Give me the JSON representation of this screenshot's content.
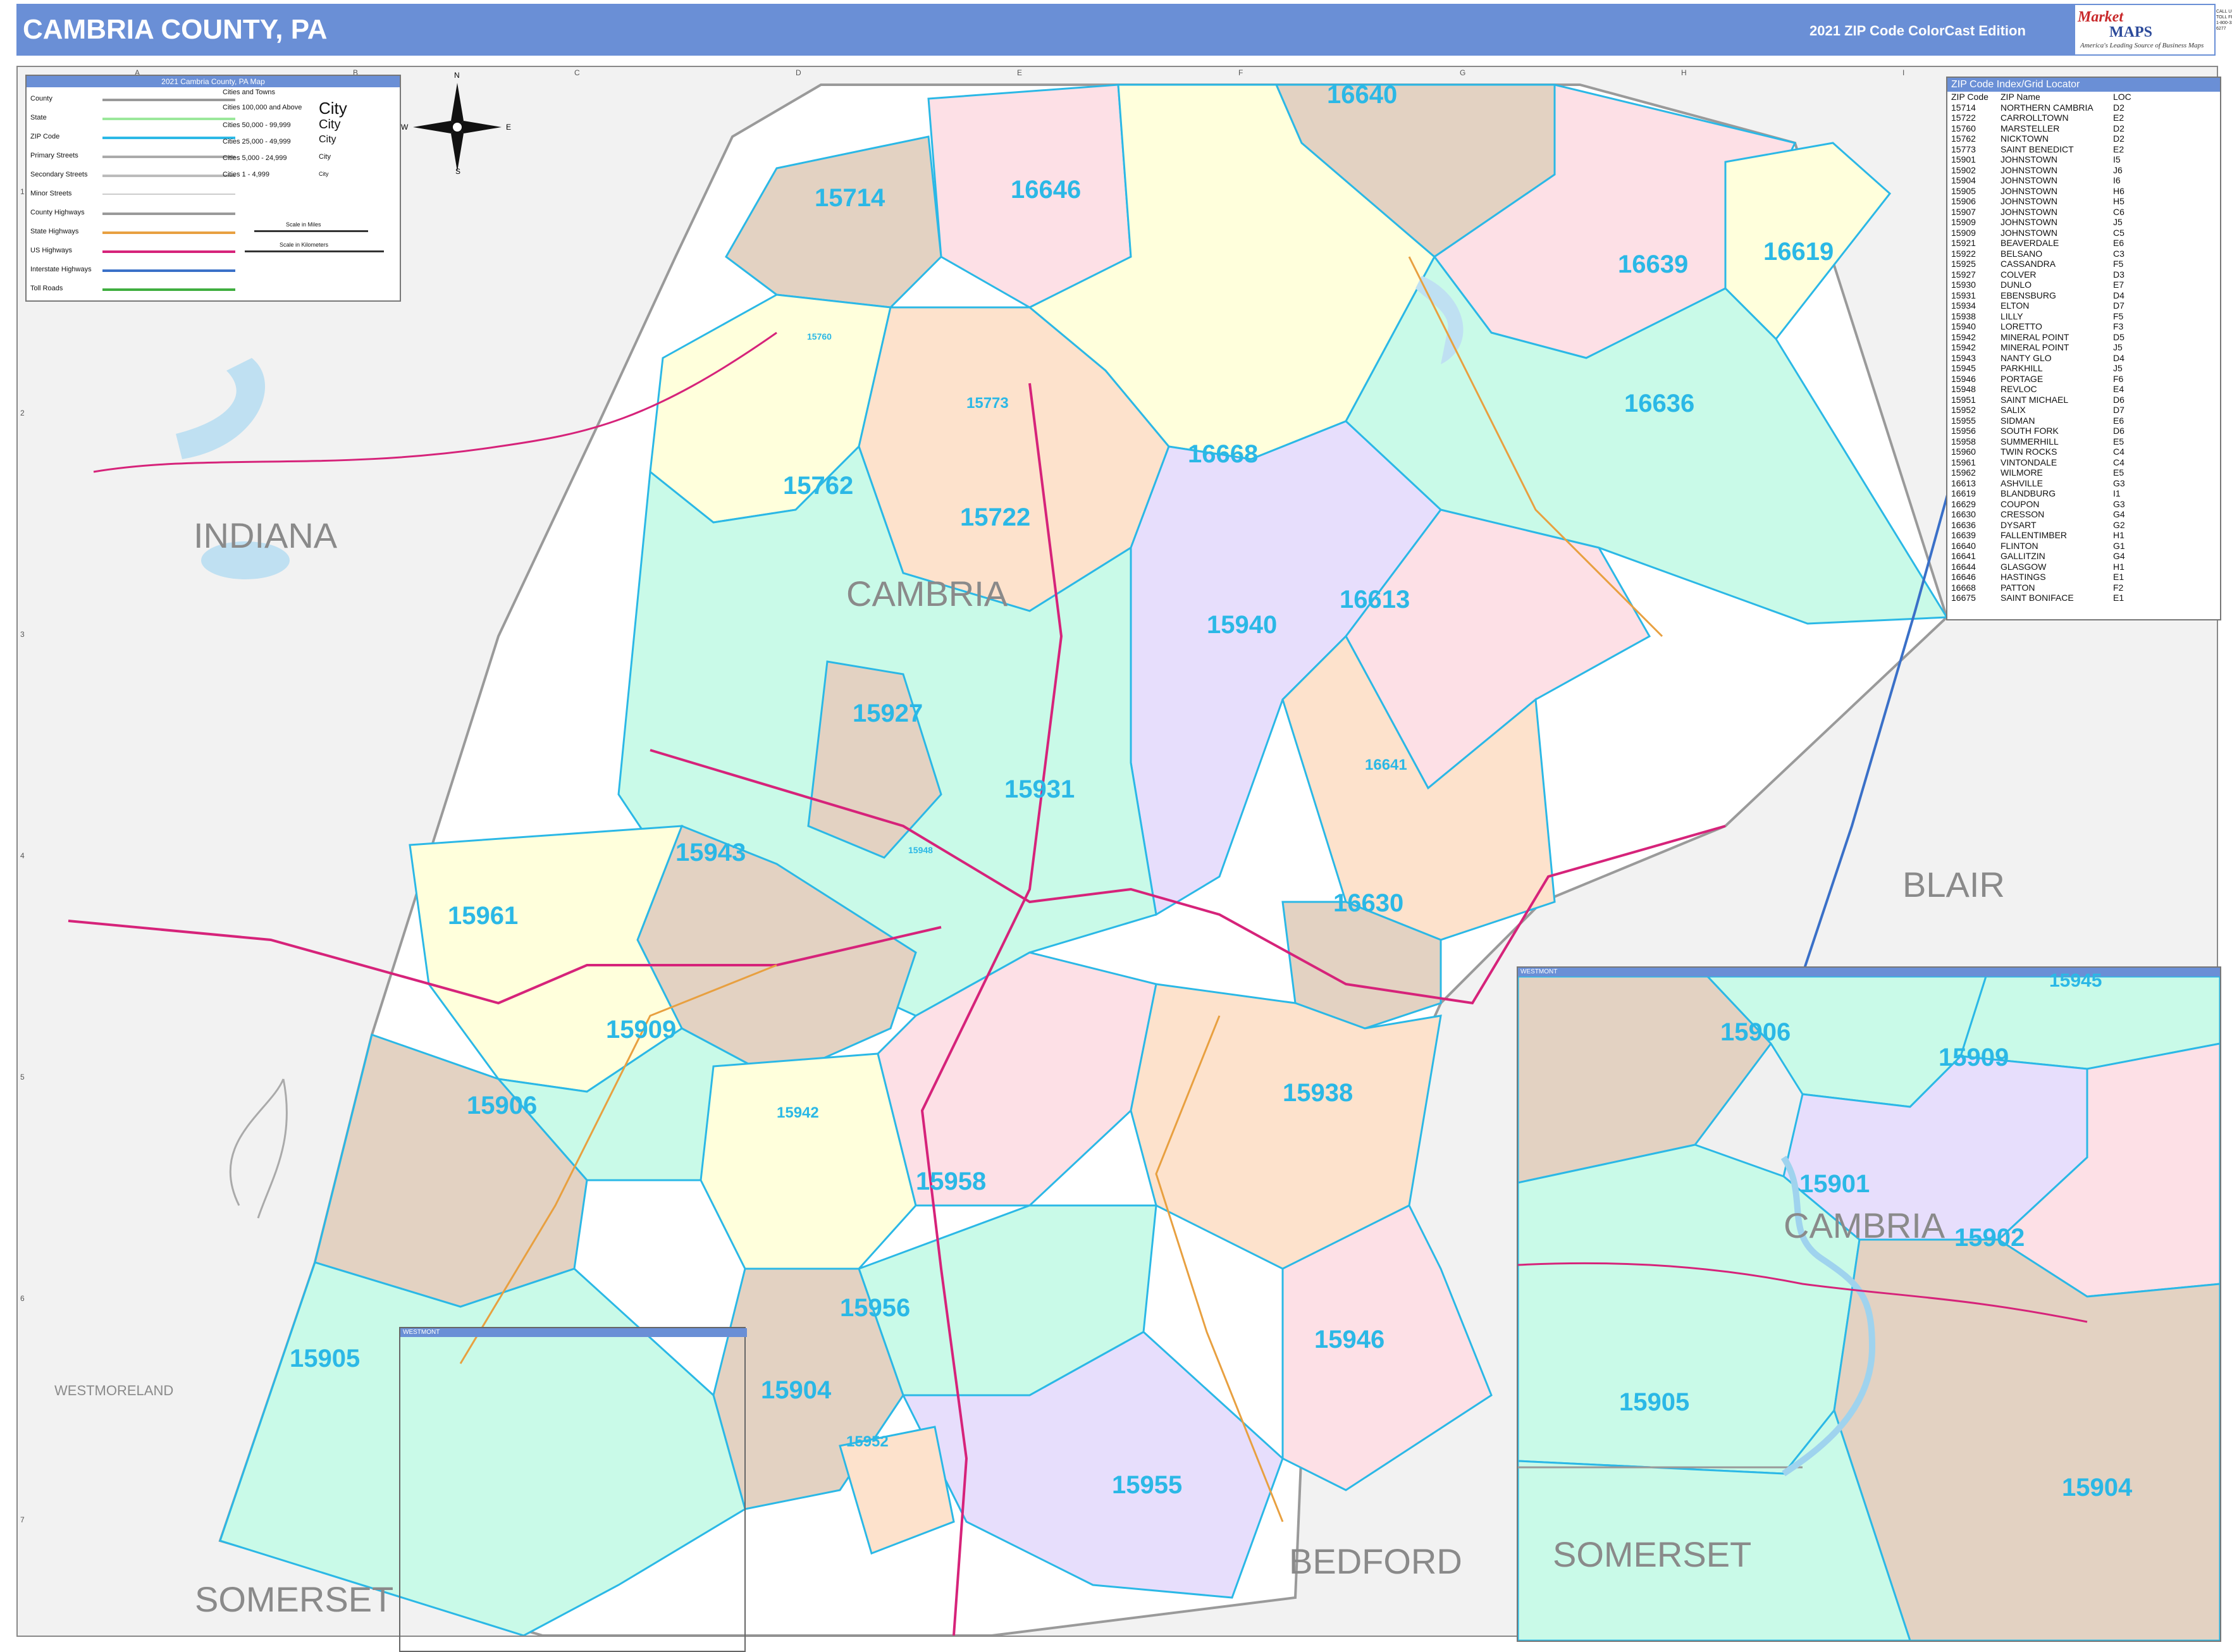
{
  "header": {
    "title": "CAMBRIA COUNTY, PA",
    "edition": "2021 ZIP Code ColorCast Edition",
    "logo_part1": "Market",
    "logo_part2": "MAPS",
    "logo_tagline": "America's Leading Source of Business Maps",
    "logo_contact": "CALL US TOLL FREE 1-800-334-6277"
  },
  "grid": {
    "letters": [
      "A",
      "B",
      "C",
      "D",
      "E",
      "F",
      "G",
      "H",
      "I"
    ],
    "numbers": [
      "1",
      "2",
      "3",
      "4",
      "5",
      "6",
      "7"
    ]
  },
  "legend": {
    "title": "2021 Cambria County, PA Map",
    "items": [
      {
        "label": "County",
        "color": "#999999"
      },
      {
        "label": "State",
        "color": "#9be89b"
      },
      {
        "label": "ZIP Code",
        "color": "#2bb8e6"
      },
      {
        "label": "Primary Streets",
        "color": "#aaaaaa"
      },
      {
        "label": "Secondary Streets",
        "color": "#bbbbbb"
      },
      {
        "label": "Minor Streets",
        "color": "#cccccc"
      },
      {
        "label": "County Highways",
        "color": "#999999"
      },
      {
        "label": "State Highways",
        "color": "#e8a040"
      },
      {
        "label": "US Highways",
        "color": "#d6237a"
      },
      {
        "label": "Interstate Highways",
        "color": "#3a70c8"
      },
      {
        "label": "Toll Roads",
        "color": "#3fae3f"
      }
    ],
    "cities_title": "Cities and Towns",
    "city_sizes": [
      {
        "label": "Cities 100,000 and Above",
        "sample": "City"
      },
      {
        "label": "Cities 50,000 - 99,999",
        "sample": "City"
      },
      {
        "label": "Cities 25,000 - 49,999",
        "sample": "City"
      },
      {
        "label": "Cities 5,000 - 24,999",
        "sample": "City"
      },
      {
        "label": "Cities 1 - 4,999",
        "sample": "City"
      }
    ],
    "scale_miles": "Scale in Miles",
    "scale_km": "Scale in Kilometers"
  },
  "compass": {
    "n": "N",
    "s": "S",
    "e": "E",
    "w": "W"
  },
  "zip_index": {
    "title": "ZIP Code Index/Grid Locator",
    "columns": [
      "ZIP Code",
      "ZIP Name",
      "LOC"
    ],
    "rows": [
      [
        "15714",
        "NORTHERN CAMBRIA",
        "D2"
      ],
      [
        "15722",
        "CARROLLTOWN",
        "E2"
      ],
      [
        "15760",
        "MARSTELLER",
        "D2"
      ],
      [
        "15762",
        "NICKTOWN",
        "D2"
      ],
      [
        "15773",
        "SAINT BENEDICT",
        "E2"
      ],
      [
        "15901",
        "JOHNSTOWN",
        "I5"
      ],
      [
        "15902",
        "JOHNSTOWN",
        "J6"
      ],
      [
        "15904",
        "JOHNSTOWN",
        "I6"
      ],
      [
        "15905",
        "JOHNSTOWN",
        "H6"
      ],
      [
        "15906",
        "JOHNSTOWN",
        "H5"
      ],
      [
        "15907",
        "JOHNSTOWN",
        "C6"
      ],
      [
        "15909",
        "JOHNSTOWN",
        "J5"
      ],
      [
        "15909",
        "JOHNSTOWN",
        "C5"
      ],
      [
        "15921",
        "BEAVERDALE",
        "E6"
      ],
      [
        "15922",
        "BELSANO",
        "C3"
      ],
      [
        "15925",
        "CASSANDRA",
        "F5"
      ],
      [
        "15927",
        "COLVER",
        "D3"
      ],
      [
        "15930",
        "DUNLO",
        "E7"
      ],
      [
        "15931",
        "EBENSBURG",
        "D4"
      ],
      [
        "15934",
        "ELTON",
        "D7"
      ],
      [
        "15938",
        "LILLY",
        "F5"
      ],
      [
        "15940",
        "LORETTO",
        "F3"
      ],
      [
        "15942",
        "MINERAL POINT",
        "D5"
      ],
      [
        "15942",
        "MINERAL POINT",
        "J5"
      ],
      [
        "15943",
        "NANTY GLO",
        "D4"
      ],
      [
        "15945",
        "PARKHILL",
        "J5"
      ],
      [
        "15946",
        "PORTAGE",
        "F6"
      ],
      [
        "15948",
        "REVLOC",
        "E4"
      ],
      [
        "15951",
        "SAINT MICHAEL",
        "D6"
      ],
      [
        "15952",
        "SALIX",
        "D7"
      ],
      [
        "15955",
        "SIDMAN",
        "E6"
      ],
      [
        "15956",
        "SOUTH FORK",
        "D6"
      ],
      [
        "15958",
        "SUMMERHILL",
        "E5"
      ],
      [
        "15960",
        "TWIN ROCKS",
        "C4"
      ],
      [
        "15961",
        "VINTONDALE",
        "C4"
      ],
      [
        "15962",
        "WILMORE",
        "E5"
      ],
      [
        "16613",
        "ASHVILLE",
        "G3"
      ],
      [
        "16619",
        "BLANDBURG",
        "I1"
      ],
      [
        "16629",
        "COUPON",
        "G3"
      ],
      [
        "16630",
        "CRESSON",
        "G4"
      ],
      [
        "16636",
        "DYSART",
        "G2"
      ],
      [
        "16639",
        "FALLENTIMBER",
        "H1"
      ],
      [
        "16640",
        "FLINTON",
        "G1"
      ],
      [
        "16641",
        "GALLITZIN",
        "G4"
      ],
      [
        "16644",
        "GLASGOW",
        "H1"
      ],
      [
        "16646",
        "HASTINGS",
        "E1"
      ],
      [
        "16668",
        "PATTON",
        "F2"
      ],
      [
        "16675",
        "SAINT BONIFACE",
        "E1"
      ]
    ]
  },
  "main_zip_labels": [
    "16640",
    "16646",
    "15714",
    "16639",
    "16619",
    "16636",
    "15773",
    "16668",
    "15762",
    "15722",
    "16613",
    "15940",
    "15927",
    "15931",
    "16641",
    "15943",
    "15961",
    "16630",
    "15909",
    "15906",
    "15942",
    "15938",
    "15958",
    "15956",
    "15946",
    "15905",
    "15904",
    "15952",
    "15955",
    "15760",
    "15948"
  ],
  "county_labels": {
    "main": "CAMBRIA",
    "indiana": "INDIANA",
    "blair": "BLAIR",
    "westmoreland": "WESTMORELAND",
    "somerset": "SOMERSET",
    "bedford": "BEDFORD"
  },
  "inset": {
    "title": "WESTMONT",
    "zip_labels": [
      "15945",
      "15906",
      "15909",
      "15901",
      "15902",
      "15905",
      "15904"
    ],
    "county_labels": [
      "CAMBRIA",
      "SOMERSET"
    ]
  },
  "small_inset": {
    "title": "WESTMONT"
  },
  "colors": {
    "header_blue": "#6a8fd6",
    "zip_label": "#2bb8e6",
    "zip_boundary": "#2bb8e6",
    "fill_pink": "#fde0e6",
    "fill_yellow": "#ffffdc",
    "fill_tan": "#e3d2c2",
    "fill_mint": "#c9fae8",
    "fill_lavender": "#e7defc",
    "fill_peach": "#fde2cc",
    "water": "#bfe0f2"
  }
}
